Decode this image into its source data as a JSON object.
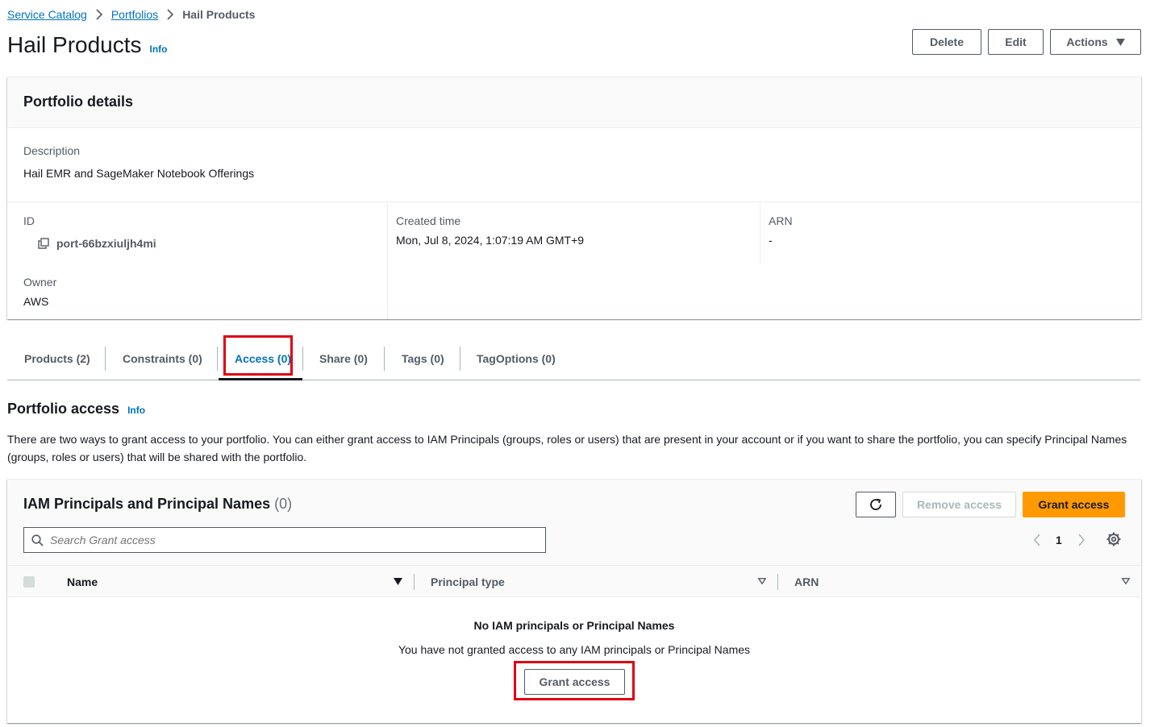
{
  "breadcrumb": {
    "items": [
      "Service Catalog",
      "Portfolios"
    ],
    "current": "Hail Products"
  },
  "header": {
    "title": "Hail Products",
    "info": "Info",
    "buttons": {
      "delete": "Delete",
      "edit": "Edit",
      "actions": "Actions"
    }
  },
  "details": {
    "title": "Portfolio details",
    "description_label": "Description",
    "description_value": "Hail EMR and SageMaker Notebook Offerings",
    "id_label": "ID",
    "id_value": "port-66bzxiuljh4mi",
    "owner_label": "Owner",
    "owner_value": "AWS",
    "created_label": "Created time",
    "created_value": "Mon, Jul 8, 2024, 1:07:19 AM GMT+9",
    "arn_label": "ARN",
    "arn_value": "-"
  },
  "tabs": [
    {
      "label": "Products (2)"
    },
    {
      "label": "Constraints (0)"
    },
    {
      "label": "Access (0)"
    },
    {
      "label": "Share (0)"
    },
    {
      "label": "Tags (0)"
    },
    {
      "label": "TagOptions (0)"
    }
  ],
  "access": {
    "title": "Portfolio access",
    "info": "Info",
    "description": "There are two ways to grant access to your portfolio. You can either grant access to IAM Principals (groups, roles or users) that are present in your account or if you want to share the portfolio, you can specify Principal Names (groups, roles or users) that will be shared with the portfolio."
  },
  "principals": {
    "title": "IAM Principals and Principal Names",
    "count": "(0)",
    "remove_label": "Remove access",
    "grant_label": "Grant access",
    "search_placeholder": "Search Grant access",
    "page": "1",
    "columns": {
      "name": "Name",
      "type": "Principal type",
      "arn": "ARN"
    },
    "empty_title": "No IAM principals or Principal Names",
    "empty_text": "You have not granted access to any IAM principals or Principal Names",
    "empty_button": "Grant access"
  },
  "colors": {
    "accent": "#0073bb",
    "primary_button": "#ff9900",
    "highlight": "#e00012"
  }
}
